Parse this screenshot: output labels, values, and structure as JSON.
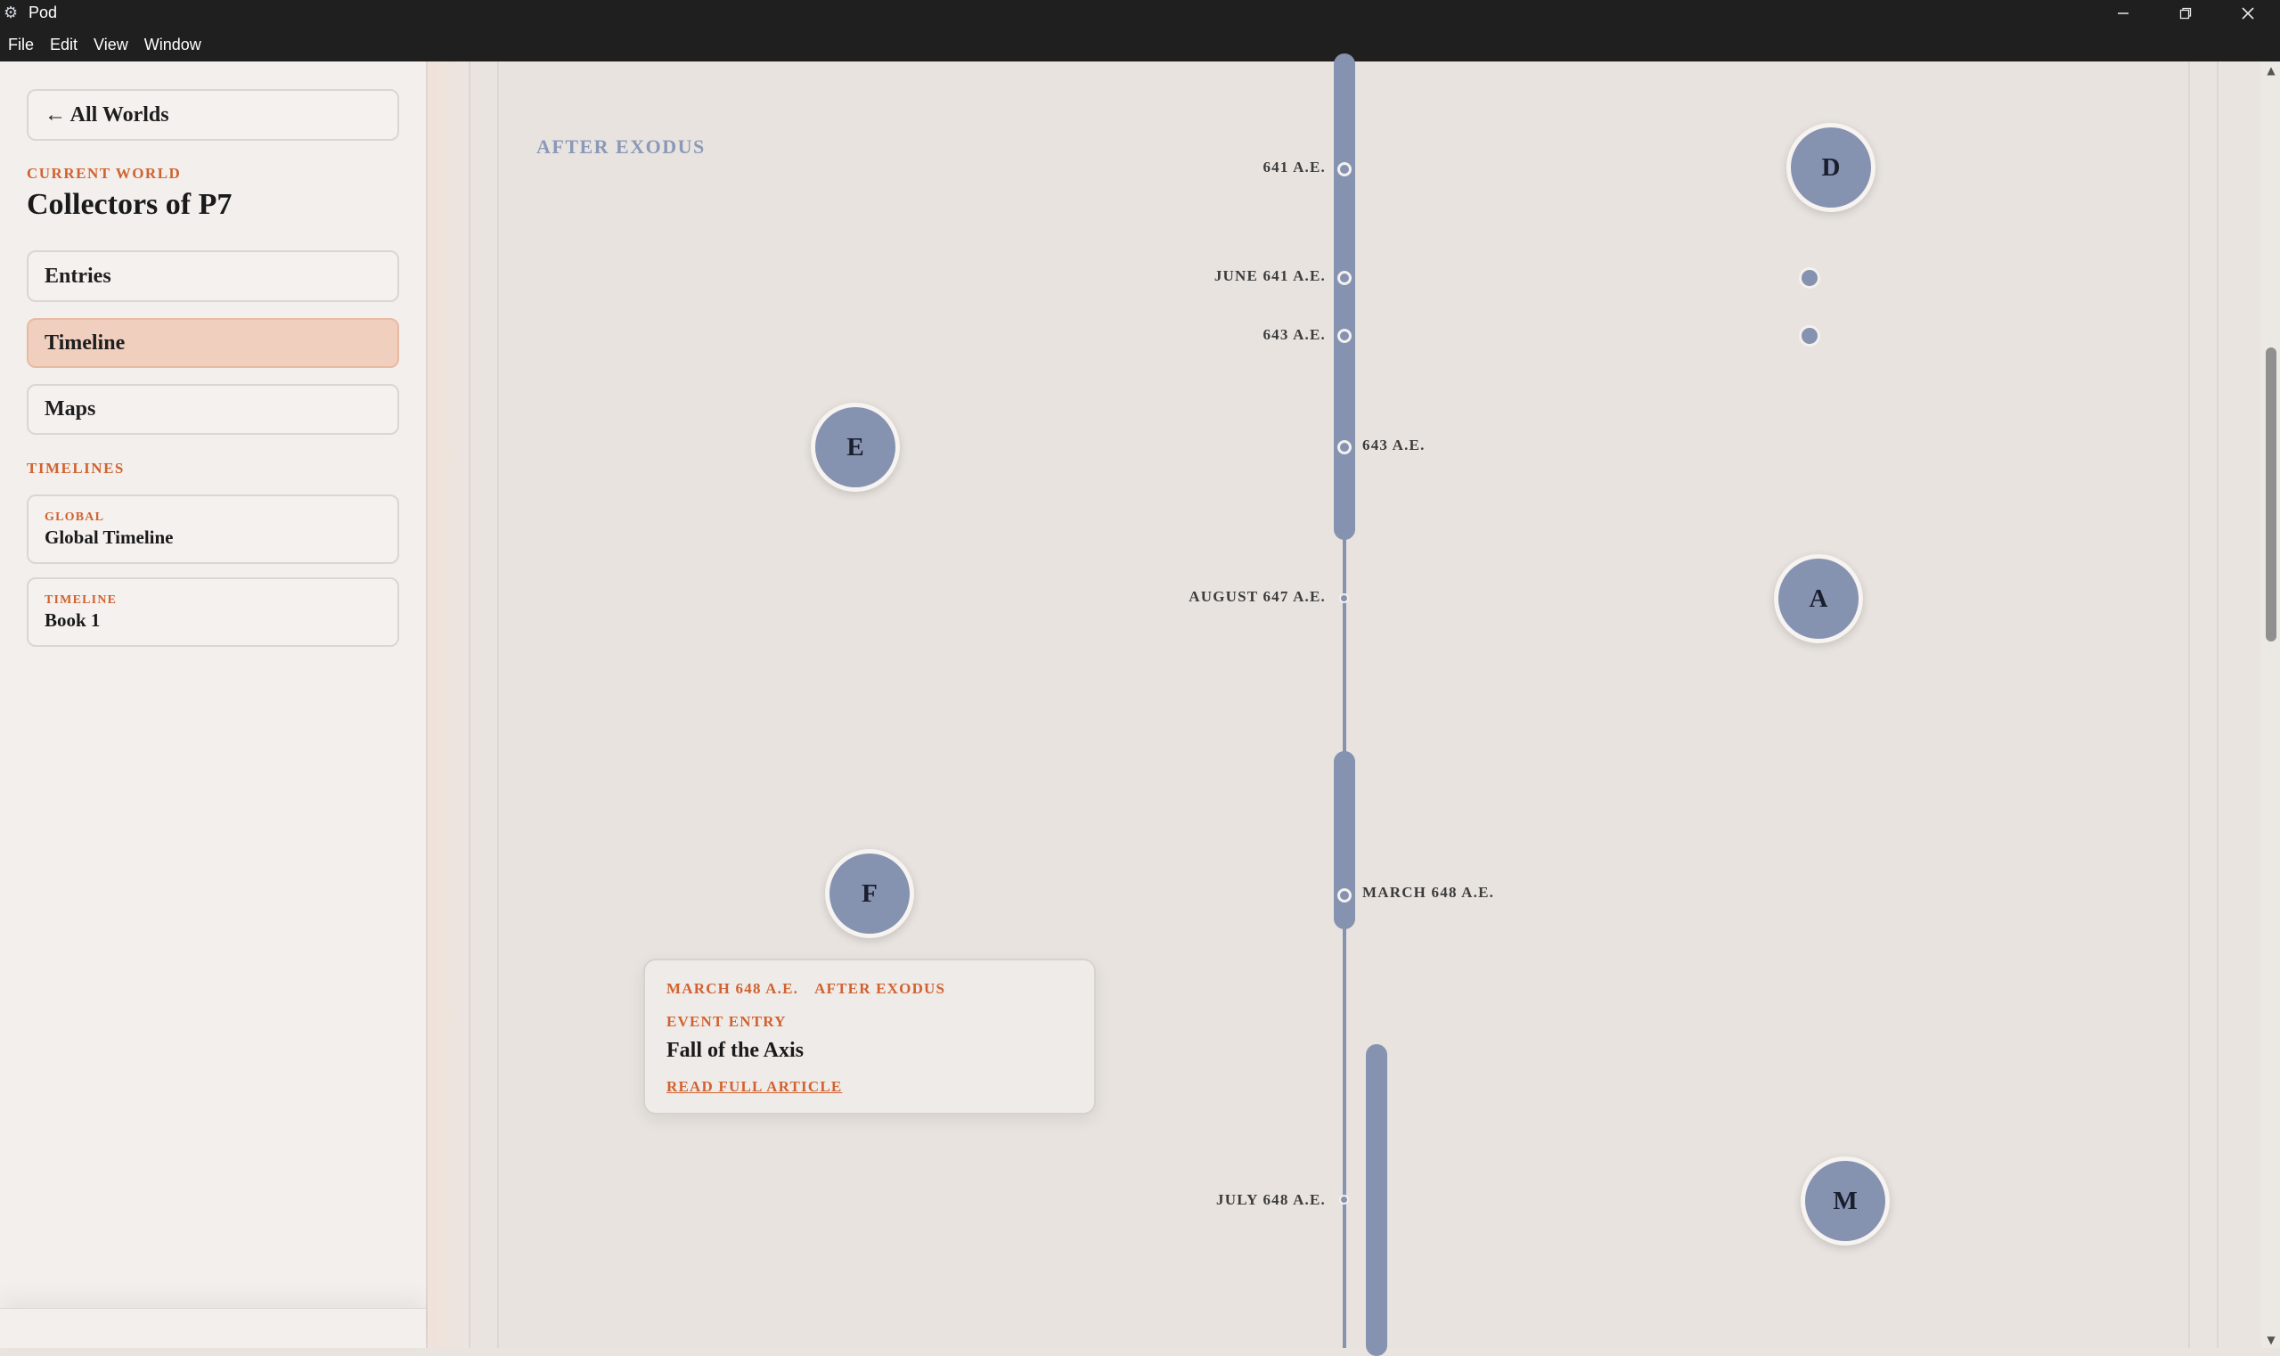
{
  "window": {
    "title": "Pod"
  },
  "menu": [
    "File",
    "Edit",
    "View",
    "Window"
  ],
  "sidebar": {
    "back_label": "← All Worlds",
    "current_world_label": "CURRENT WORLD",
    "world_name": "Collectors of P7",
    "nav": [
      {
        "label": "Entries",
        "active": false
      },
      {
        "label": "Timeline",
        "active": true
      },
      {
        "label": "Maps",
        "active": false
      }
    ],
    "timelines_label": "TIMELINES",
    "timelines": [
      {
        "kind": "GLOBAL",
        "name": "Global Timeline"
      },
      {
        "kind": "TIMELINE",
        "name": "Book 1"
      }
    ]
  },
  "timeline": {
    "era": "AFTER EXODUS",
    "dates": [
      "641 A.E.",
      "JUNE 641 A.E.",
      "643 A.E.",
      "643 A.E.",
      "AUGUST 647 A.E.",
      "MARCH 648 A.E.",
      "JULY 648 A.E."
    ],
    "nodes": [
      "D",
      "E",
      "A",
      "F",
      "M"
    ]
  },
  "popup": {
    "date": "MARCH 648 A.E.",
    "era": "AFTER EXODUS",
    "kind": "EVENT ENTRY",
    "title": "Fall of the Axis",
    "link": "READ FULL ARTICLE"
  },
  "colors": {
    "accent": "#d1622f",
    "node": "#8592b0",
    "active_nav": "#f0cfbf",
    "titlebar": "#1f1f1f"
  }
}
